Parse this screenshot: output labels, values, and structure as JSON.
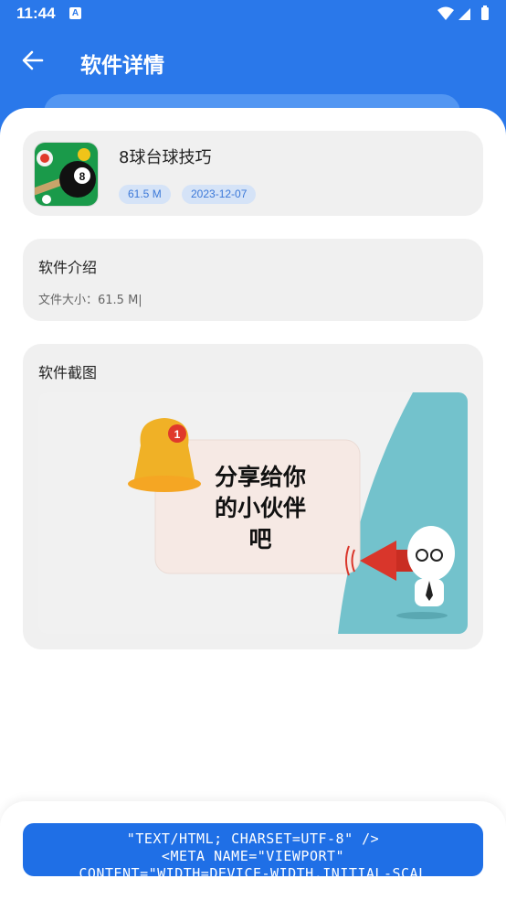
{
  "status_bar": {
    "time": "11:44",
    "notif_letter": "A"
  },
  "toolbar": {
    "back_icon": "arrow-left-icon",
    "title": "软件详情"
  },
  "app": {
    "name": "8球台球技巧",
    "size_badge": "61.5 M",
    "date_badge": "2023-12-07",
    "icon": "billiards-8-ball-icon"
  },
  "intro": {
    "title": "软件介绍",
    "file_size": "文件大小：61.5 M|"
  },
  "screenshots": {
    "title": "软件截图",
    "image_text_line1": "分享给你",
    "image_text_line2": "的小伙伴",
    "image_text_line3": "吧",
    "badge_number": "1"
  },
  "bottom_button": {
    "line1": "\"TEXT/HTML; CHARSET=UTF-8\" />",
    "line2": "<META NAME=\"VIEWPORT\"",
    "line3": "CONTENT=\"WIDTH=DEVICE-WIDTH,INITIAL-SCAL"
  },
  "colors": {
    "primary": "#2a78ea",
    "card": "#f0f0f0",
    "badge_bg": "#d5e3f7"
  }
}
